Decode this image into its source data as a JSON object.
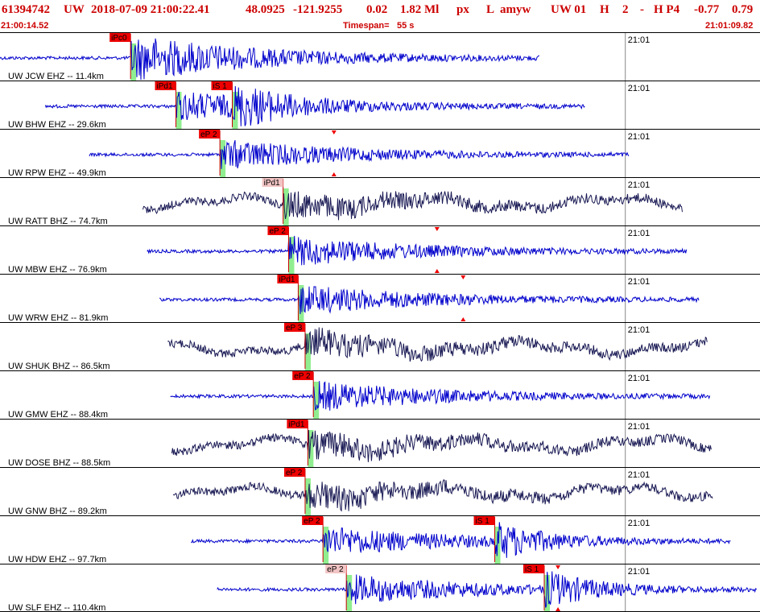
{
  "header": {
    "event_id": "61394742",
    "network": "UW",
    "origin_datetime": "2018-07-09 21:00:22.41",
    "latitude": "48.0925",
    "longitude": "-121.9255",
    "depth": "0.02",
    "magnitude": "1.82 Ml",
    "event_type": "px",
    "flag": "L",
    "analyst": "amyw",
    "solution": "UW 01",
    "gtype": "H",
    "count": "2",
    "dash": "-",
    "hp": "H P4",
    "val1": "-0.77",
    "val2": "0.79"
  },
  "subheader": {
    "start_time": "21:00:14.52",
    "timespan_label": "Timespan=",
    "timespan_value": "55 s",
    "end_time": "21:01:09.82"
  },
  "colors": {
    "header_text": "#cc0000",
    "trace_ehz": "#0000cc",
    "trace_bhz": "#1a1a55",
    "pick_box": "#ee0000",
    "pick_light": "#f2c4c4",
    "pick_line": "#cc0000",
    "pick_band": "#90ee90",
    "minute_line": "#888888",
    "separator": "#000000"
  },
  "chart_data": {
    "type": "line",
    "title": "",
    "x_unit": "seconds after 21:00:14.52",
    "xlim": [
      0,
      55.3
    ],
    "minute_mark": {
      "label": "21:01",
      "t": 45.5
    },
    "traces": [
      {
        "label": "UW JCW EHZ -- 11.4km",
        "station": "JCW",
        "channel": "EHZ",
        "distance_km": 11.4,
        "start": 0.0,
        "end": 39.3,
        "picks": [
          {
            "label": "iPc0",
            "t": 9.5,
            "style": "dark"
          }
        ],
        "markers": []
      },
      {
        "label": "UW BHW EHZ -- 29.6km",
        "station": "BHW",
        "channel": "EHZ",
        "distance_km": 29.6,
        "start": 3.3,
        "end": 42.6,
        "picks": [
          {
            "label": "iPd1",
            "t": 12.8,
            "style": "dark"
          },
          {
            "label": "iS 1",
            "t": 16.9,
            "style": "dark"
          }
        ],
        "markers": []
      },
      {
        "label": "UW RPW EHZ -- 49.9km",
        "station": "RPW",
        "channel": "EHZ",
        "distance_km": 49.9,
        "start": 6.5,
        "end": 45.8,
        "picks": [
          {
            "label": "eP 2",
            "t": 16.0,
            "style": "dark"
          }
        ],
        "markers": [
          {
            "t": 24.3
          }
        ]
      },
      {
        "label": "UW RATT BHZ -- 74.7km",
        "station": "RATT",
        "channel": "BHZ",
        "distance_km": 74.7,
        "start": 10.4,
        "end": 49.7,
        "picks": [
          {
            "label": "iPd1",
            "t": 20.6,
            "style": "light"
          }
        ],
        "markers": []
      },
      {
        "label": "UW MBW EHZ -- 76.9km",
        "station": "MBW",
        "channel": "EHZ",
        "distance_km": 76.9,
        "start": 10.7,
        "end": 50.0,
        "picks": [
          {
            "label": "eP 2",
            "t": 21.0,
            "style": "dark"
          }
        ],
        "markers": [
          {
            "t": 31.8
          }
        ]
      },
      {
        "label": "UW WRW EHZ -- 81.9km",
        "station": "WRW",
        "channel": "EHZ",
        "distance_km": 81.9,
        "start": 11.6,
        "end": 50.9,
        "picks": [
          {
            "label": "iPd1",
            "t": 21.7,
            "style": "dark"
          }
        ],
        "markers": [
          {
            "t": 33.7
          }
        ]
      },
      {
        "label": "UW SHUK BHZ -- 86.5km",
        "station": "SHUK",
        "channel": "BHZ",
        "distance_km": 86.5,
        "start": 12.2,
        "end": 51.5,
        "picks": [
          {
            "label": "eP 3",
            "t": 22.2,
            "style": "dark"
          }
        ],
        "markers": []
      },
      {
        "label": "UW GMW EHZ -- 88.4km",
        "station": "GMW",
        "channel": "EHZ",
        "distance_km": 88.4,
        "start": 12.4,
        "end": 51.7,
        "picks": [
          {
            "label": "eP 2",
            "t": 22.8,
            "style": "dark"
          }
        ],
        "markers": []
      },
      {
        "label": "UW DOSE BHZ -- 88.5km",
        "station": "DOSE",
        "channel": "BHZ",
        "distance_km": 88.5,
        "start": 12.5,
        "end": 51.8,
        "picks": [
          {
            "label": "iPd1",
            "t": 22.4,
            "style": "dark"
          }
        ],
        "markers": []
      },
      {
        "label": "UW GNW BHZ -- 89.2km",
        "station": "GNW",
        "channel": "BHZ",
        "distance_km": 89.2,
        "start": 12.6,
        "end": 51.9,
        "picks": [
          {
            "label": "eP 2",
            "t": 22.2,
            "style": "dark"
          }
        ],
        "markers": []
      },
      {
        "label": "UW HDW EHZ -- 97.7km",
        "station": "HDW",
        "channel": "EHZ",
        "distance_km": 97.7,
        "start": 13.9,
        "end": 53.2,
        "picks": [
          {
            "label": "eP 2",
            "t": 23.5,
            "style": "dark"
          },
          {
            "label": "iS 1",
            "t": 36.0,
            "style": "dark"
          }
        ],
        "markers": []
      },
      {
        "label": "UW SLF EHZ -- 110.4km",
        "station": "SLF",
        "channel": "EHZ",
        "distance_km": 110.4,
        "start": 15.8,
        "end": 55.1,
        "picks": [
          {
            "label": "eP 2",
            "t": 25.2,
            "style": "light"
          },
          {
            "label": "iS 1",
            "t": 39.6,
            "style": "dark"
          }
        ],
        "markers": [
          {
            "t": 40.6
          }
        ]
      }
    ]
  }
}
